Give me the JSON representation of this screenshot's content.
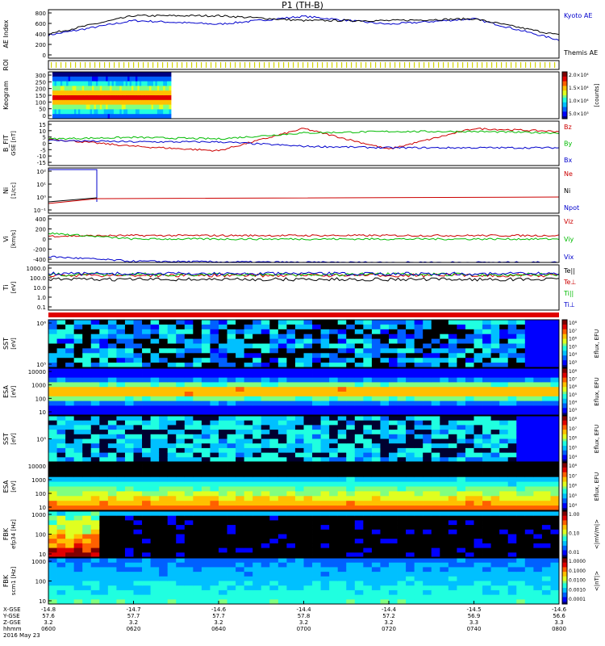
{
  "title": "P1 (TH-B)",
  "footer": {
    "row_labels": [
      "X-GSE",
      "Y-GSE",
      "Z-GSE",
      "hhmm"
    ],
    "date": "2016 May 23",
    "ticks": [
      {
        "x": "-14.8",
        "y": "57.6",
        "z": "3.2",
        "t": "0600"
      },
      {
        "x": "-14.7",
        "y": "57.7",
        "z": "3.2",
        "t": "0620"
      },
      {
        "x": "-14.6",
        "y": "57.7",
        "z": "3.2",
        "t": "0640"
      },
      {
        "x": "-14.4",
        "y": "57.8",
        "z": "3.2",
        "t": "0700"
      },
      {
        "x": "-14.4",
        "y": "57.2",
        "z": "3.2",
        "t": "0720"
      },
      {
        "x": "-14.5",
        "y": "56.9",
        "z": "3.3",
        "t": "0740"
      },
      {
        "x": "-14.6",
        "y": "56.6",
        "z": "3.3",
        "t": "0800"
      }
    ]
  },
  "chart_data": [
    {
      "type": "line",
      "panel": "ae",
      "ylabel": "AE Index",
      "yticks": [
        "800",
        "600",
        "400",
        "200",
        "0"
      ],
      "ylim": [
        0,
        800
      ],
      "x": [
        "0600",
        "0620",
        "0640",
        "0700",
        "0720",
        "0740",
        "0800"
      ],
      "series": [
        {
          "name": "Kyoto AE",
          "color": "#0000cc",
          "values": [
            380,
            620,
            560,
            690,
            560,
            650,
            300
          ]
        },
        {
          "name": "Themis AE",
          "color": "#000000",
          "values": [
            400,
            700,
            700,
            620,
            620,
            650,
            380
          ]
        }
      ]
    },
    {
      "type": "heatmap",
      "panel": "roi",
      "ylabel": "ROI",
      "colors": [
        "#d4d400"
      ]
    },
    {
      "type": "heatmap",
      "panel": "keogram",
      "ylabel": "Keogram",
      "yticks": [
        "300",
        "250",
        "200",
        "150",
        "100",
        "50",
        "0"
      ],
      "ylim": [
        0,
        300
      ],
      "x_extent": [
        "0600",
        "0614"
      ],
      "colorbar": {
        "label": "[counts]",
        "ticks": [
          "2.0×10⁴",
          "1.5×10⁴",
          "1.0×10⁴",
          "5.0×10³"
        ]
      }
    },
    {
      "type": "line",
      "panel": "bfield",
      "ylabel": "B_FIT",
      "units": "GSE [nT]",
      "yticks": [
        "15",
        "10",
        "5",
        "0",
        "-5",
        "-10",
        "-15"
      ],
      "ylim": [
        -15,
        15
      ],
      "x": [
        "0600",
        "0620",
        "0640",
        "0700",
        "0720",
        "0740",
        "0800"
      ],
      "series": [
        {
          "name": "Bz",
          "color": "#cc0000",
          "values": [
            3,
            -2,
            -5,
            10,
            -4,
            10,
            8
          ]
        },
        {
          "name": "By",
          "color": "#00bb00",
          "values": [
            3,
            4,
            3,
            7,
            8,
            8,
            7
          ]
        },
        {
          "name": "Bx",
          "color": "#0000cc",
          "values": [
            2,
            1,
            1,
            -2,
            -3,
            -3,
            -3
          ]
        }
      ]
    },
    {
      "type": "line",
      "panel": "density",
      "ylabel": "Ni",
      "units": "[1/cc]",
      "yticks": [
        "10²",
        "10¹",
        "10⁰",
        "10⁻¹"
      ],
      "series": [
        {
          "name": "Ne",
          "color": "#cc0000"
        },
        {
          "name": "Ni",
          "color": "#000000"
        },
        {
          "name": "Npot",
          "color": "#0000cc"
        }
      ]
    },
    {
      "type": "line",
      "panel": "velocity",
      "ylabel": "Vi",
      "units": "[km/s]",
      "yticks": [
        "400",
        "200",
        "0",
        "-200",
        "-400"
      ],
      "ylim": [
        -400,
        400
      ],
      "x": [
        "0600",
        "0620",
        "0640",
        "0700",
        "0720",
        "0740",
        "0800"
      ],
      "series": [
        {
          "name": "Viz",
          "color": "#cc0000",
          "values": [
            50,
            60,
            60,
            60,
            60,
            60,
            60
          ]
        },
        {
          "name": "Viy",
          "color": "#00bb00",
          "values": [
            100,
            0,
            0,
            0,
            0,
            0,
            0
          ]
        },
        {
          "name": "Vix",
          "color": "#0000cc",
          "values": [
            -300,
            -380,
            -390,
            -400,
            -400,
            -400,
            -400
          ]
        }
      ]
    },
    {
      "type": "line",
      "panel": "temperature",
      "ylabel": "Ti",
      "units": "[eV]",
      "yticks": [
        "1000.0",
        "100.0",
        "10.0",
        "1.0",
        "0.1"
      ],
      "series": [
        {
          "name": "Te||",
          "color": "#000000"
        },
        {
          "name": "Te⊥",
          "color": "#cc0000"
        },
        {
          "name": "Ti||",
          "color": "#00bb00"
        },
        {
          "name": "Ti⊥",
          "color": "#0000cc"
        }
      ]
    },
    {
      "type": "heatmap",
      "panel": "sst_i",
      "ylabel": "SST",
      "units": "[eV]",
      "yticks": [
        "10⁶",
        "10⁵"
      ],
      "colorbar": {
        "label": "Eflux, EFU",
        "ticks": [
          "10⁸",
          "10⁷",
          "10⁶",
          "10⁵",
          "10⁴",
          "10³"
        ]
      }
    },
    {
      "type": "heatmap",
      "panel": "esa_i",
      "ylabel": "ESA",
      "units": "[eV]",
      "yticks": [
        "10000",
        "1000",
        "100",
        "10"
      ],
      "colorbar": {
        "label": "Eflux, EFU",
        "ticks": [
          "10⁸",
          "10⁷",
          "10⁶",
          "10⁵",
          "10⁴",
          "10³"
        ]
      }
    },
    {
      "type": "heatmap",
      "panel": "sst_e",
      "ylabel": "SST",
      "units": "[eV]",
      "yticks": [
        "10⁵"
      ],
      "colorbar": {
        "label": "Eflux, EFU",
        "ticks": [
          "10⁸",
          "10⁷",
          "10⁶",
          "10⁵",
          "10⁴"
        ]
      }
    },
    {
      "type": "heatmap",
      "panel": "esa_e",
      "ylabel": "ESA",
      "units": "[eV]",
      "yticks": [
        "10000",
        "1000",
        "100",
        "10"
      ],
      "colorbar": {
        "label": "Eflux, EFU",
        "ticks": [
          "10⁸",
          "10⁷",
          "10⁶",
          "10⁵",
          "10⁴"
        ]
      }
    },
    {
      "type": "heatmap",
      "panel": "fbk_e",
      "ylabel": "FBK",
      "units": "efp34 [Hz]",
      "yticks": [
        "1000",
        "100",
        "10"
      ],
      "colorbar": {
        "label": "<|mV/m|>",
        "ticks": [
          "1.00",
          "0.10",
          "0.01"
        ]
      }
    },
    {
      "type": "heatmap",
      "panel": "fbk_b",
      "ylabel": "FBK",
      "units": "scm1 [Hz]",
      "yticks": [
        "1000",
        "100",
        "10"
      ],
      "colorbar": {
        "label": "<|nT|>",
        "ticks": [
          "1.0000",
          "0.1000",
          "0.0100",
          "0.0010",
          "0.0001"
        ]
      }
    }
  ]
}
